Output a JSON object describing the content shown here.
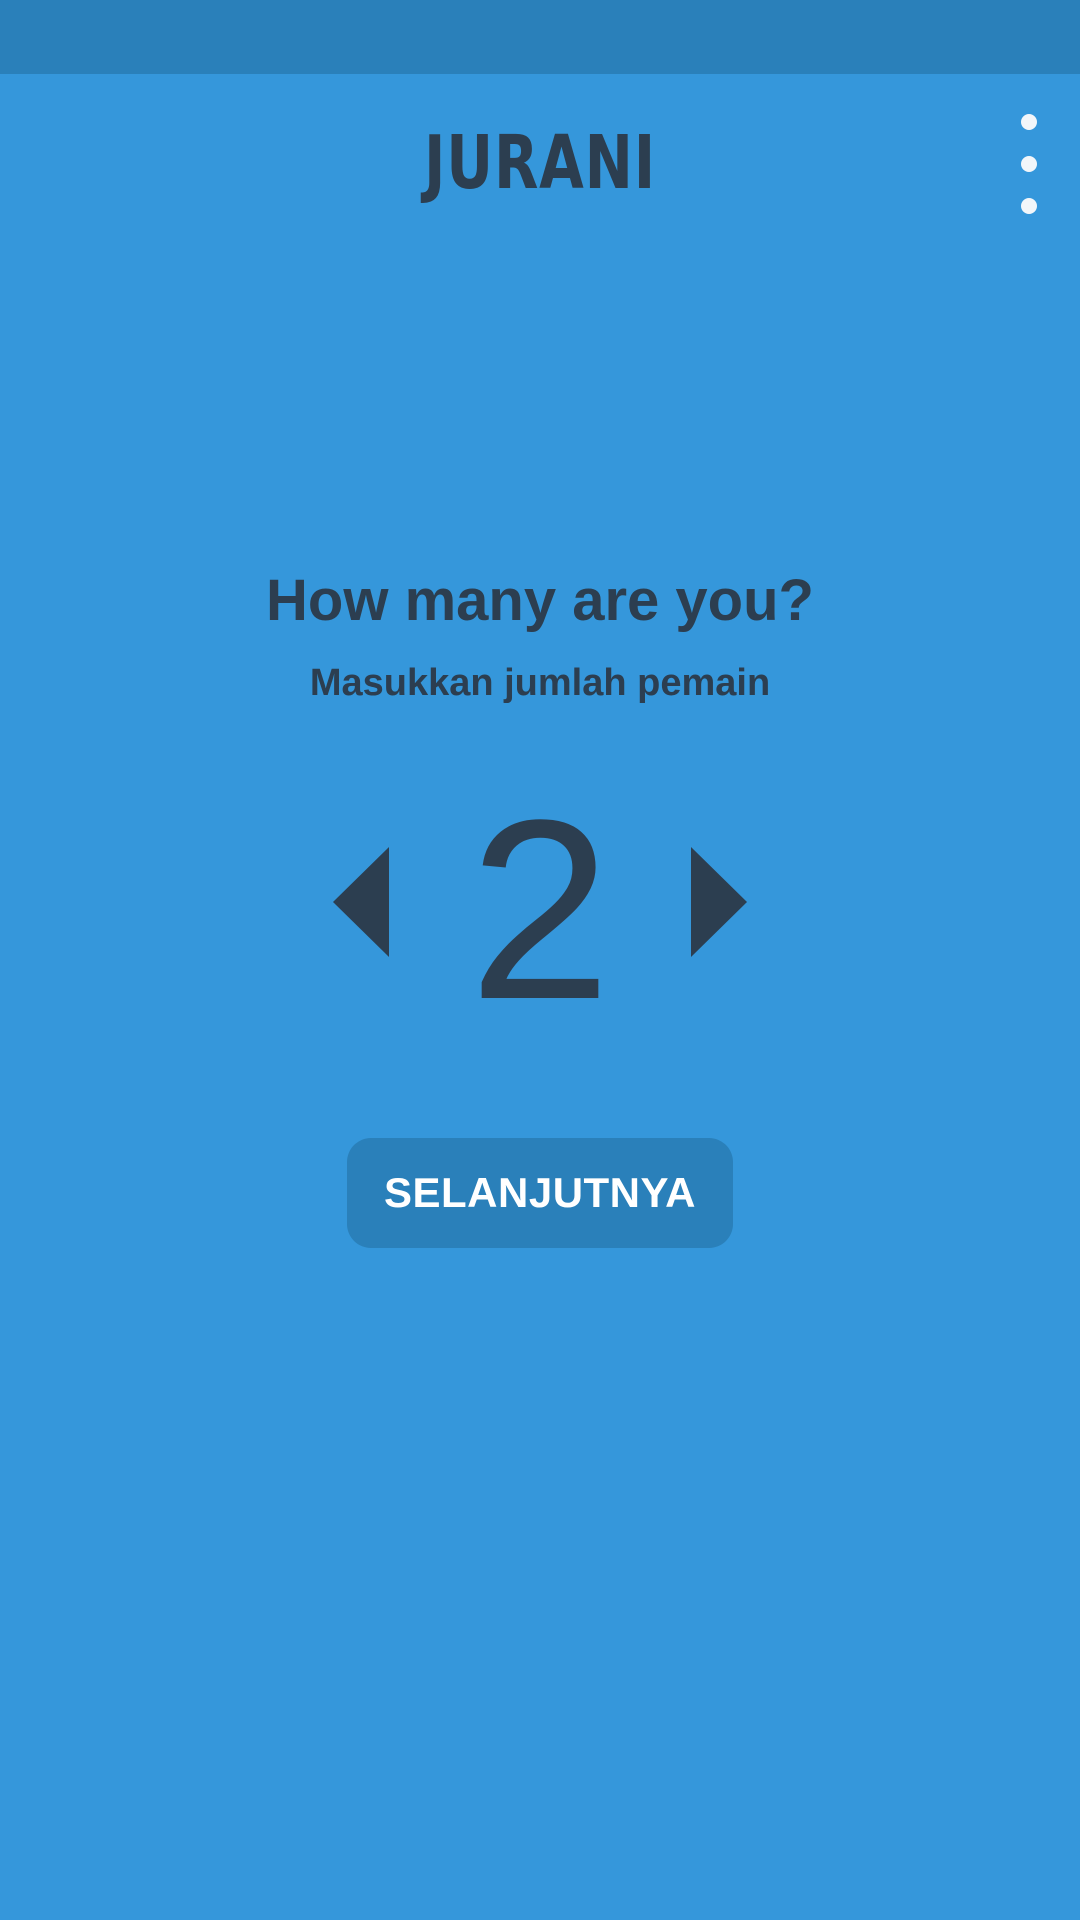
{
  "app": {
    "logo_text": "JURANI"
  },
  "menu": {
    "icon": "more-vert-icon"
  },
  "main": {
    "title": "How many are you?",
    "subtitle": "Masukkan jumlah pemain",
    "player_count": "2",
    "decrement_icon": "triangle-left-icon",
    "increment_icon": "triangle-right-icon",
    "next_label": "SELANJUTNYA"
  },
  "colors": {
    "background": "#3597DB",
    "status_bar": "#2A80BA",
    "text_dark": "#2C3E50",
    "button_bg": "#2A80BA",
    "button_text": "#FFFFFF",
    "menu_dots": "#F2F6FA"
  }
}
